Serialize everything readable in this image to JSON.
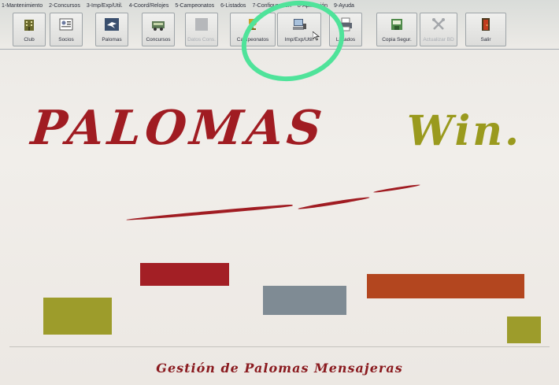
{
  "menu": {
    "items": [
      "1-Mantenimiento",
      "2-Concursos",
      "3-Imp/Exp/Util.",
      "4-Coord/Relojes",
      "5-Campeonatos",
      "6-Listados",
      "7-Configuración",
      "8-Aplicación",
      "9-Ayuda"
    ]
  },
  "toolbar": {
    "buttons": [
      {
        "label": "Club",
        "icon": "building-icon",
        "enabled": true
      },
      {
        "label": "Socios",
        "icon": "members-icon",
        "enabled": true
      },
      {
        "label": "Palomas",
        "icon": "pigeon-icon",
        "enabled": true
      },
      {
        "label": "Concursos",
        "icon": "truck-icon",
        "enabled": true
      },
      {
        "label": "Datos Cons.",
        "icon": "blank-icon",
        "enabled": false
      },
      {
        "label": "Campeonatos",
        "icon": "trophy-icon",
        "enabled": true
      },
      {
        "label": "Imp/Exp/Util.",
        "icon": "computer-icon",
        "enabled": true
      },
      {
        "label": "Listados",
        "icon": "printer-icon",
        "enabled": true
      },
      {
        "label": "Copia Segur.",
        "icon": "backup-icon",
        "enabled": true
      },
      {
        "label": "Actualizar BD",
        "icon": "tools-icon",
        "enabled": false
      },
      {
        "label": "Salir",
        "icon": "exit-door-icon",
        "enabled": true
      }
    ]
  },
  "logo": {
    "title": "PALOMAS",
    "suffix": "Win."
  },
  "footer": {
    "text": "Gestión de Palomas Mensajeras"
  },
  "colors": {
    "brand_red": "#a01c22",
    "brand_olive": "#9a9a1e",
    "slate": "#7f8b94",
    "orange": "#b3461f",
    "annotation_green": "#4fe39a"
  }
}
